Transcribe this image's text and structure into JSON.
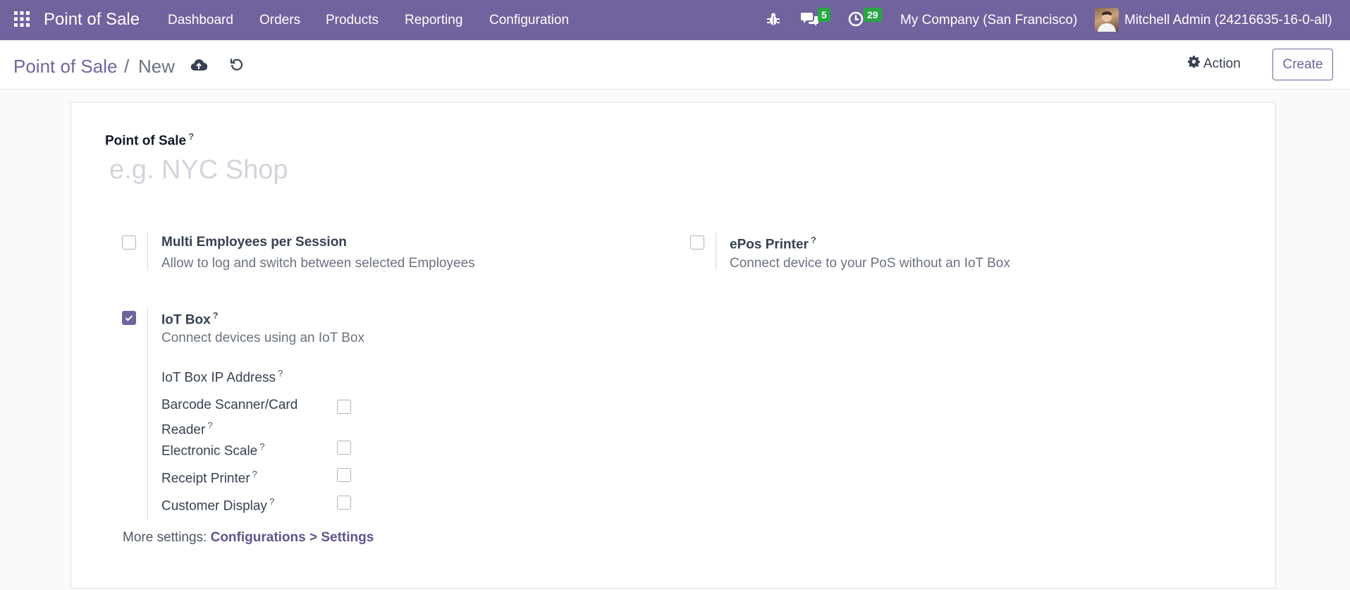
{
  "navbar": {
    "apps_icon": "grid-icon",
    "brand": "Point of Sale",
    "menu": [
      "Dashboard",
      "Orders",
      "Products",
      "Reporting",
      "Configuration"
    ],
    "debug_icon": "bug-icon",
    "messages_icon": "chat-icon",
    "messages_count": "5",
    "activities_icon": "clock-icon",
    "activities_count": "29",
    "company": "My Company (San Francisco)",
    "user": "Mitchell Admin (24216635-16-0-all)",
    "accent_color": "#71639e",
    "badge_color": "#28a745"
  },
  "control_panel": {
    "breadcrumb_root": "Point of Sale",
    "breadcrumb_separator": "/",
    "breadcrumb_current": "New",
    "save_icon": "cloud-upload-icon",
    "discard_icon": "undo-icon",
    "action_icon": "gear-icon",
    "action_label": "Action",
    "create_label": "Create"
  },
  "form": {
    "name_label": "Point of Sale",
    "help_mark": "?",
    "name_value": "",
    "name_placeholder": "e.g. NYC Shop",
    "multi_employees": {
      "title": "Multi Employees per Session",
      "description": "Allow to log and switch between selected Employees",
      "checked": false
    },
    "epos_printer": {
      "title": "ePos Printer",
      "description": "Connect device to your PoS without an IoT Box",
      "checked": false
    },
    "iot_box": {
      "title": "IoT Box",
      "description": "Connect devices using an IoT Box",
      "checked": true,
      "ip_label": "IoT Box IP Address",
      "devices": [
        {
          "label": "Barcode Scanner/Card Reader",
          "checked": false
        },
        {
          "label": "Electronic Scale",
          "checked": false
        },
        {
          "label": "Receipt Printer",
          "checked": false
        },
        {
          "label": "Customer Display",
          "checked": false
        }
      ]
    },
    "more_settings_prefix": "More settings:",
    "more_settings_link": "Configurations > Settings"
  }
}
